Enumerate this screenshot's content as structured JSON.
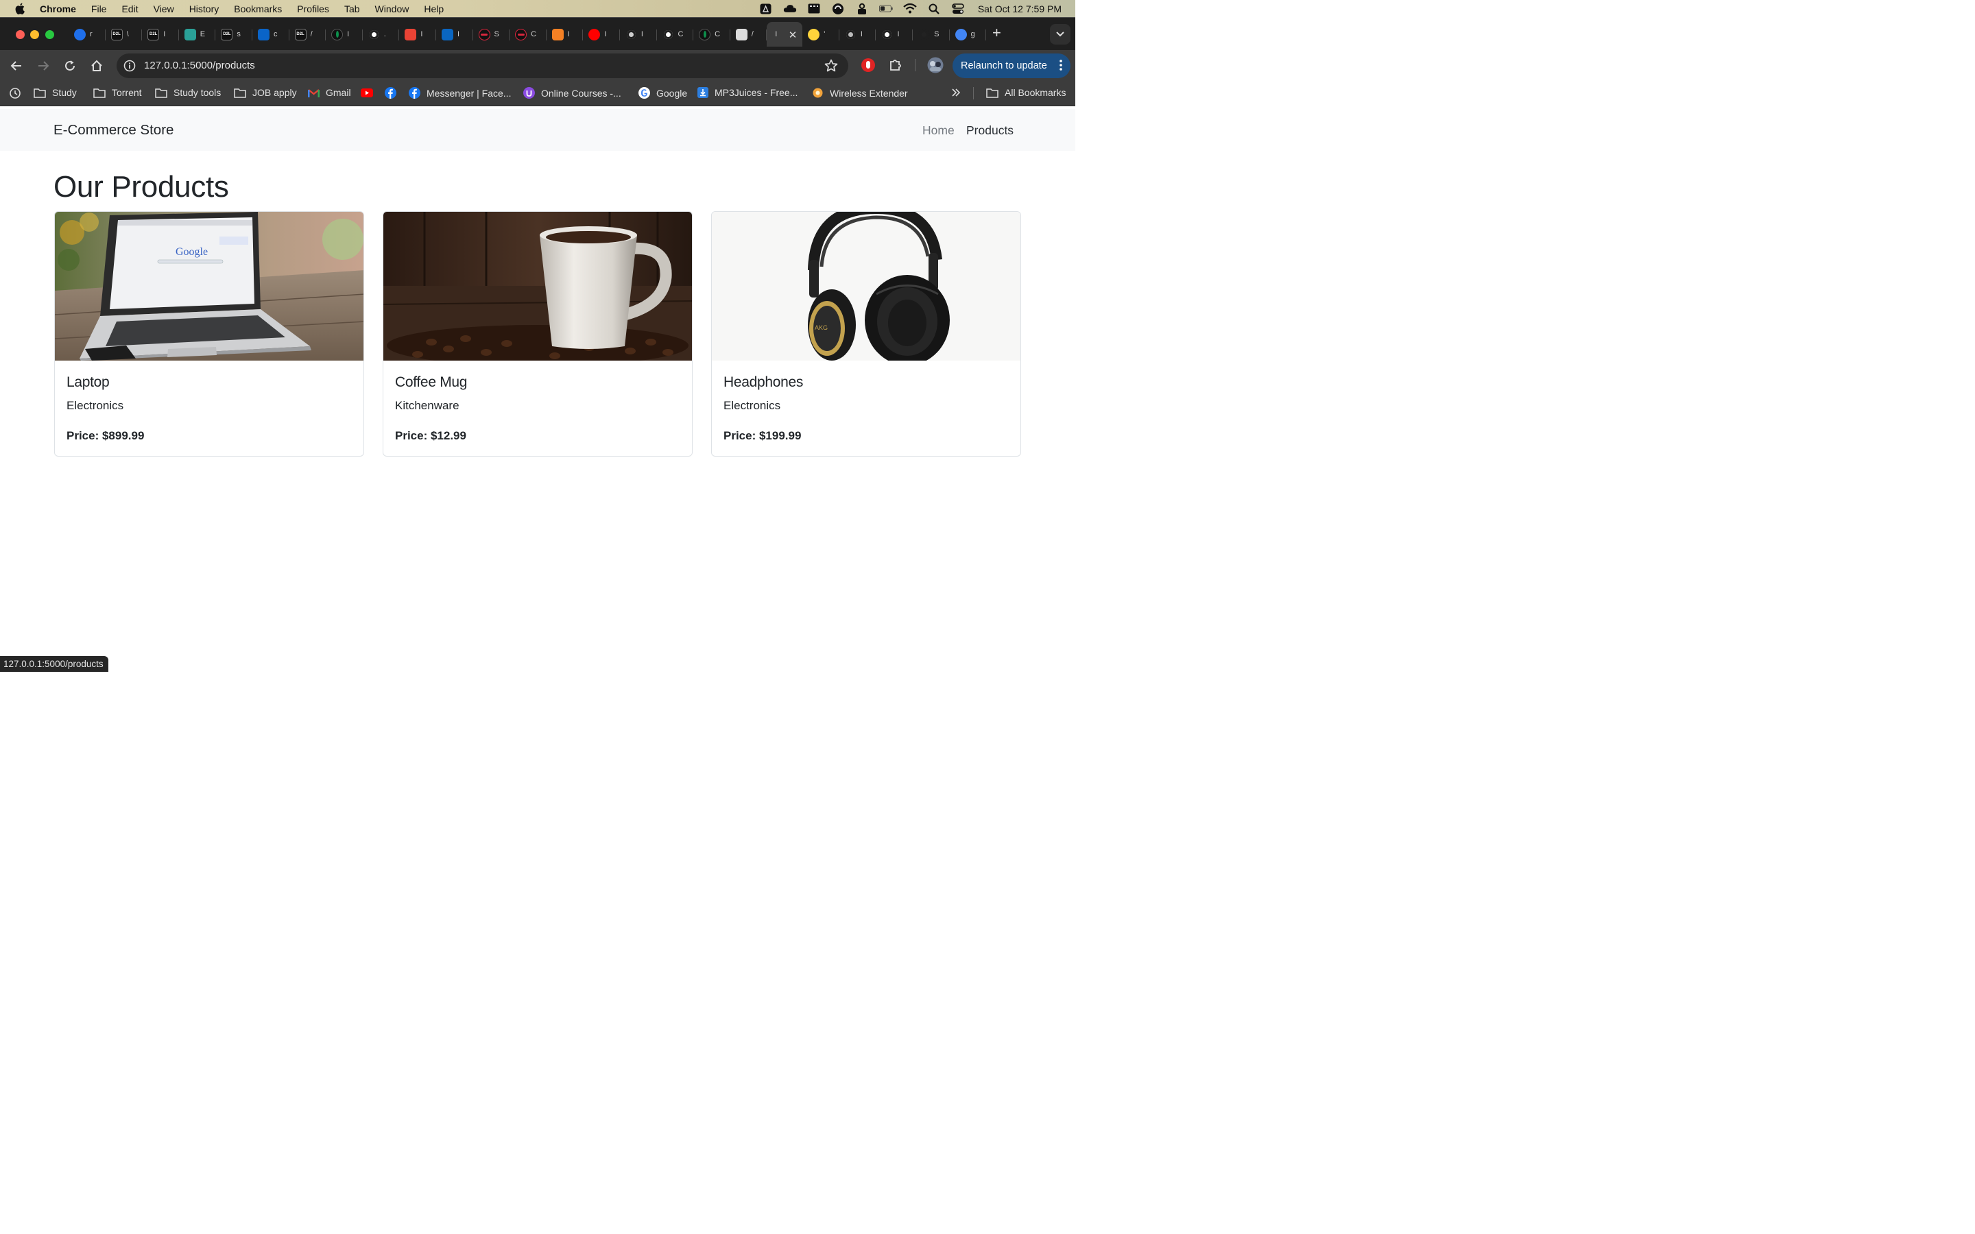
{
  "os_menu": {
    "app": "Chrome",
    "items": [
      "File",
      "Edit",
      "View",
      "History",
      "Bookmarks",
      "Profiles",
      "Tab",
      "Window",
      "Help"
    ],
    "clock": "Sat Oct 12  7:59 PM"
  },
  "tabs": {
    "items": [
      {
        "icon": "blue-app-icon",
        "label": "r",
        "color": "#1f6feb"
      },
      {
        "icon": "d2l-icon",
        "label": "\\",
        "color": "#111111"
      },
      {
        "icon": "d2l-icon",
        "label": "I",
        "color": "#111111"
      },
      {
        "icon": "teal-doc-icon",
        "label": "E",
        "color": "#2aa198"
      },
      {
        "icon": "d2l-icon",
        "label": "s",
        "color": "#111111"
      },
      {
        "icon": "outlook-icon",
        "label": "c",
        "color": "#0a64c8"
      },
      {
        "icon": "d2l-icon",
        "label": "/",
        "color": "#111111"
      },
      {
        "icon": "leaf-icon",
        "label": "I",
        "color": "#0d8f4c"
      },
      {
        "icon": "github-icon",
        "label": ".",
        "color": "#ffffff"
      },
      {
        "icon": "gmail-icon",
        "label": "I",
        "color": "#ea4335"
      },
      {
        "icon": "linkedin-icon",
        "label": "I",
        "color": "#0a66c2"
      },
      {
        "icon": "red-swirl-icon",
        "label": "S",
        "color": "#d7263d"
      },
      {
        "icon": "red-swirl-icon",
        "label": "C",
        "color": "#d7263d"
      },
      {
        "icon": "orange-stack-icon",
        "label": "I",
        "color": "#f48024"
      },
      {
        "icon": "youtube-icon",
        "label": "I",
        "color": "#ff0000"
      },
      {
        "icon": "chrome-icon",
        "label": "I",
        "color": "#cccccc"
      },
      {
        "icon": "openai-icon",
        "label": "C",
        "color": "#ffffff"
      },
      {
        "icon": "leaf-icon",
        "label": "C",
        "color": "#0d8f4c"
      },
      {
        "icon": "perplexity-icon",
        "label": "/",
        "color": "#dddddd"
      },
      {
        "icon": "active-tab-icon",
        "label": "I",
        "color": "#dddddd"
      },
      {
        "icon": "python-icon",
        "label": "'",
        "color": "#ffd43b"
      },
      {
        "icon": "globe-icon",
        "label": "I",
        "color": "#bbbbbb"
      },
      {
        "icon": "github-icon",
        "label": "I",
        "color": "#ffffff"
      },
      {
        "icon": "dark-circle-icon",
        "label": "S",
        "color": "#222222"
      },
      {
        "icon": "google-icon",
        "label": "g",
        "color": "#4285f4"
      }
    ]
  },
  "toolbar": {
    "url": "127.0.0.1:5000/products",
    "relaunch_label": "Relaunch to update"
  },
  "bookmarks": {
    "items": [
      {
        "label": "Study",
        "icon": "folder-icon"
      },
      {
        "label": "Torrent",
        "icon": "folder-icon"
      },
      {
        "label": "Study tools",
        "icon": "folder-icon"
      },
      {
        "label": "JOB apply",
        "icon": "folder-icon"
      },
      {
        "label": "Gmail",
        "icon": "gmail-icon"
      },
      {
        "label": "",
        "icon": "youtube-icon"
      },
      {
        "label": "",
        "icon": "facebook-icon"
      },
      {
        "label": "Messenger | Face...",
        "icon": "facebook-icon"
      },
      {
        "label": "Online Courses -...",
        "icon": "udemy-icon"
      },
      {
        "label": "Google",
        "icon": "google-icon"
      },
      {
        "label": "MP3Juices - Free...",
        "icon": "download-icon"
      },
      {
        "label": "Wireless Extender",
        "icon": "extender-icon"
      }
    ],
    "all_bookmarks": "All Bookmarks"
  },
  "site": {
    "brand": "E-Commerce Store",
    "nav": {
      "home": "Home",
      "products": "Products"
    },
    "title": "Our Products",
    "products": [
      {
        "name": "Laptop",
        "category": "Electronics",
        "price": "Price: $899.99",
        "image": "laptop-photo"
      },
      {
        "name": "Coffee Mug",
        "category": "Kitchenware",
        "price": "Price: $12.99",
        "image": "coffee-mug-photo"
      },
      {
        "name": "Headphones",
        "category": "Electronics",
        "price": "Price: $199.99",
        "image": "headphones-photo"
      }
    ]
  },
  "status_bar": {
    "text": "127.0.0.1:5000/products"
  }
}
